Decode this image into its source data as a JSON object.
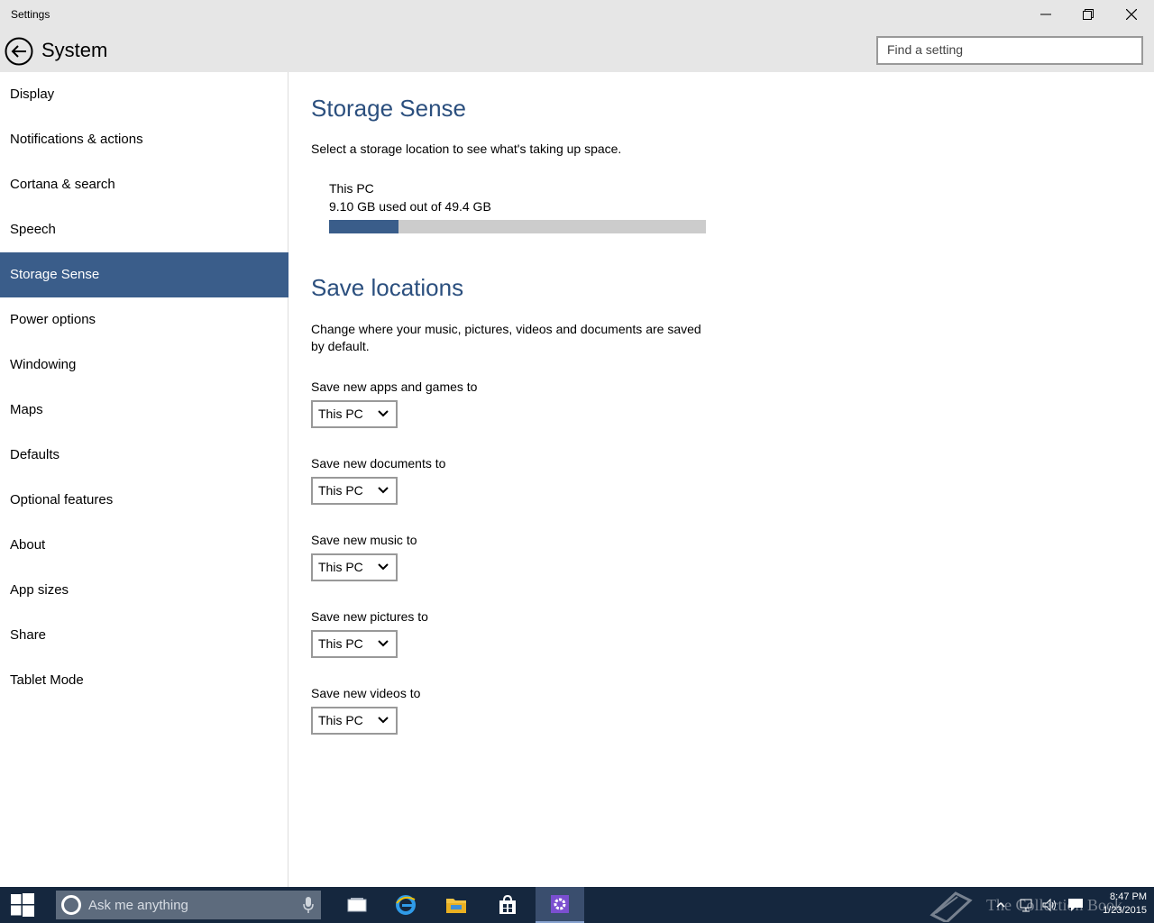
{
  "window": {
    "title": "Settings",
    "controls": {
      "minimize": "minimize-icon",
      "maximize": "restore-icon",
      "close": "close-icon"
    }
  },
  "header": {
    "title": "System",
    "back_icon": "back-arrow-icon",
    "search_placeholder": "Find a setting"
  },
  "sidebar": {
    "items": [
      {
        "label": "Display"
      },
      {
        "label": "Notifications & actions"
      },
      {
        "label": "Cortana & search"
      },
      {
        "label": "Speech"
      },
      {
        "label": "Storage Sense",
        "active": true
      },
      {
        "label": "Power options"
      },
      {
        "label": "Windowing"
      },
      {
        "label": "Maps"
      },
      {
        "label": "Defaults"
      },
      {
        "label": "Optional features"
      },
      {
        "label": "About"
      },
      {
        "label": "App sizes"
      },
      {
        "label": "Share"
      },
      {
        "label": "Tablet Mode"
      }
    ]
  },
  "storage": {
    "heading": "Storage Sense",
    "description": "Select a storage location to see what's taking up space.",
    "drive": {
      "name": "This PC",
      "usage_text": "9.10 GB used out of 49.4 GB",
      "used_fraction": 0.184
    }
  },
  "save_locations": {
    "heading": "Save locations",
    "description": "Change where your music, pictures, videos and documents are saved by default.",
    "dropdowns": [
      {
        "label": "Save new apps and games to",
        "value": "This PC"
      },
      {
        "label": "Save new documents to",
        "value": "This PC"
      },
      {
        "label": "Save new music to",
        "value": "This PC"
      },
      {
        "label": "Save new pictures to",
        "value": "This PC"
      },
      {
        "label": "Save new videos to",
        "value": "This PC"
      }
    ]
  },
  "taskbar": {
    "search_placeholder": "Ask me anything",
    "apps": [
      "task-view-icon",
      "edge-browser-icon",
      "file-explorer-icon",
      "store-icon",
      "settings-icon"
    ],
    "clock": {
      "time": "8:47 PM",
      "date": "1/23/2015"
    },
    "watermark": "The Collection Book"
  },
  "colors": {
    "accent": "#3a5d8a",
    "heading": "#2b4f7e",
    "chrome": "#e6e6e6",
    "taskbar": "#15273e"
  }
}
